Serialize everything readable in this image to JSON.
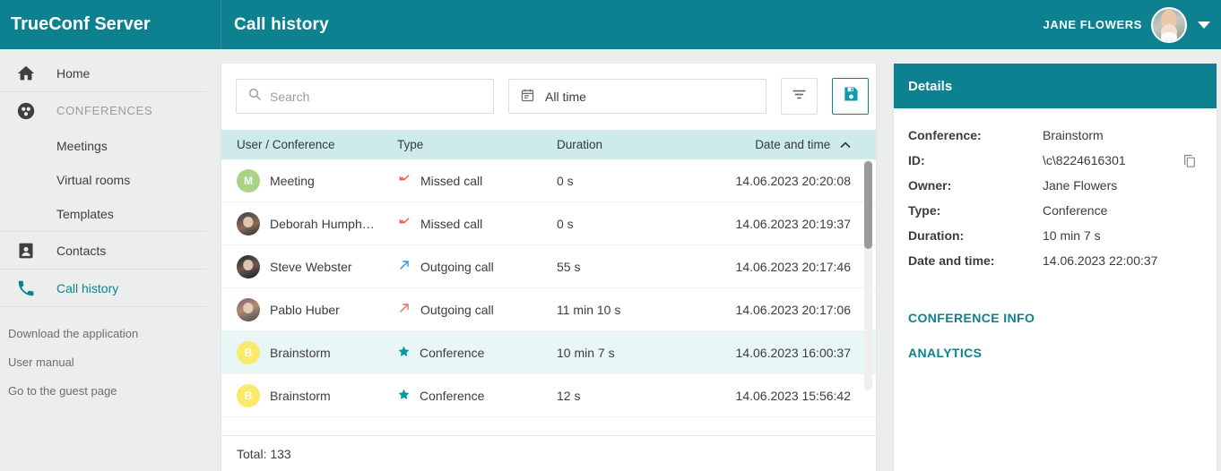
{
  "topbar": {
    "brand": "TrueConf Server",
    "page_title": "Call history",
    "username": "JANE FLOWERS",
    "avatar_name": "user-avatar",
    "chevron": "chevron-down-icon"
  },
  "sidebar": {
    "home": {
      "label": "Home",
      "icon": "home-icon"
    },
    "conferences": {
      "label": "CONFERENCES",
      "icon": "conferences-icon"
    },
    "sub_items": [
      {
        "label": "Meetings"
      },
      {
        "label": "Virtual rooms"
      },
      {
        "label": "Templates"
      }
    ],
    "contacts": {
      "label": "Contacts",
      "icon": "contacts-icon"
    },
    "call_history": {
      "label": "Call history",
      "icon": "phone-icon"
    },
    "footer_links": [
      {
        "label": "Download the application"
      },
      {
        "label": "User manual"
      },
      {
        "label": "Go to the guest page"
      }
    ]
  },
  "toolbar": {
    "search_placeholder": "Search",
    "search_value": "",
    "search_icon": "search-icon",
    "date_filter_label": "All time",
    "calendar_icon": "calendar-icon",
    "filter_icon": "filter-icon",
    "save_icon": "save-icon"
  },
  "table": {
    "columns": [
      {
        "label": "User / Conference"
      },
      {
        "label": "Type"
      },
      {
        "label": "Duration"
      },
      {
        "label": "Date and time",
        "sort": "^"
      }
    ],
    "rows": [
      {
        "name": "Meeting",
        "avatar_type": "initial",
        "avatar_initial": "M",
        "avatar_color": "#a8d484",
        "type": "Missed call",
        "type_icon": "call-missed-icon",
        "type_color": "#ef5350",
        "duration": "0 s",
        "datetime": "14.06.2023 20:20:08",
        "selected": false
      },
      {
        "name": "Deborah Humph…",
        "avatar_type": "photo-a",
        "avatar_initial": "",
        "avatar_color": "",
        "type": "Missed call",
        "type_icon": "call-missed-icon",
        "type_color": "#ef5350",
        "duration": "0 s",
        "datetime": "14.06.2023 20:19:37",
        "selected": false
      },
      {
        "name": "Steve Webster",
        "avatar_type": "photo-b",
        "avatar_initial": "",
        "avatar_color": "",
        "type": "Outgoing call",
        "type_icon": "call-made-icon",
        "type_color": "#2196f3",
        "duration": "55 s",
        "datetime": "14.06.2023 20:17:46",
        "selected": false
      },
      {
        "name": "Pablo Huber",
        "avatar_type": "photo-c",
        "avatar_initial": "",
        "avatar_color": "",
        "type": "Outgoing call",
        "type_icon": "call-made-icon",
        "type_color": "#f4685e",
        "duration": "11 min 10 s",
        "datetime": "14.06.2023 20:17:06",
        "selected": false
      },
      {
        "name": "Brainstorm",
        "avatar_type": "initial",
        "avatar_initial": "B",
        "avatar_color": "#f9ea6a",
        "type": "Conference",
        "type_icon": "star-icon",
        "type_color": "#079aa5",
        "duration": "10 min 7 s",
        "datetime": "14.06.2023 16:00:37",
        "selected": true
      },
      {
        "name": "Brainstorm",
        "avatar_type": "initial",
        "avatar_initial": "B",
        "avatar_color": "#f9ea6a",
        "type": "Conference",
        "type_icon": "star-icon",
        "type_color": "#079aa5",
        "duration": "12 s",
        "datetime": "14.06.2023 15:56:42",
        "selected": false
      }
    ],
    "total": "Total: 133"
  },
  "details": {
    "title": "Details",
    "fields": [
      {
        "label": "Conference:",
        "value": "Brainstorm",
        "copyable": false
      },
      {
        "label": "ID:",
        "value": "\\c\\8224616301",
        "copyable": true
      },
      {
        "label": "Owner:",
        "value": "Jane Flowers",
        "copyable": false
      },
      {
        "label": "Type:",
        "value": "Conference",
        "copyable": false
      },
      {
        "label": "Duration:",
        "value": "10 min 7 s",
        "copyable": false
      },
      {
        "label": "Date and time:",
        "value": "14.06.2023 22:00:37",
        "copyable": false
      }
    ],
    "links": [
      {
        "label": "CONFERENCE INFO"
      },
      {
        "label": "ANALYTICS"
      }
    ],
    "copy_icon": "copy-icon"
  },
  "colors": {
    "accent": "#0d818f",
    "table_header": "#cfeaea",
    "selected_row": "#e9f6f6",
    "sidebar_bg": "#eceded"
  }
}
